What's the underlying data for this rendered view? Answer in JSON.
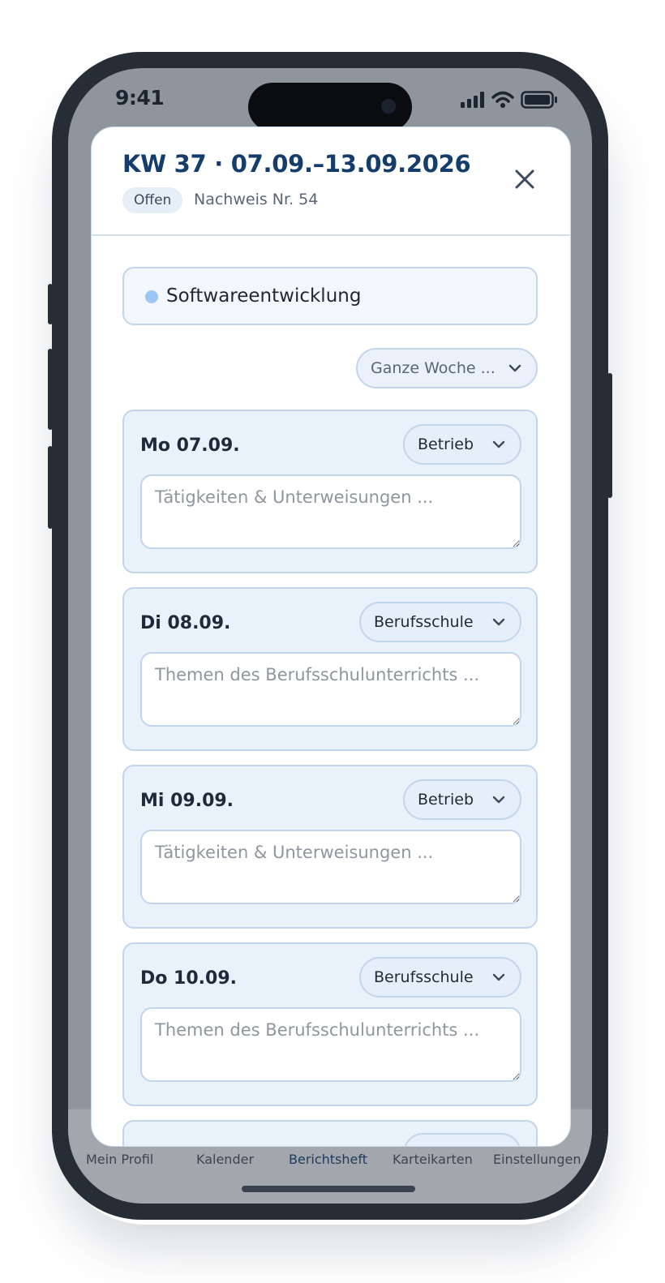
{
  "status": {
    "time": "9:41"
  },
  "sheet": {
    "title": "KW 37 · 07.09.–13.09.2026",
    "badge": "Offen",
    "nachweis": "Nachweis Nr. 54",
    "subject": "Softwareentwicklung",
    "week_select": "Ganze Woche ...",
    "days": [
      {
        "label": "Mo 07.09.",
        "type": "Betrieb",
        "placeholder": "Tätigkeiten & Unterweisungen ..."
      },
      {
        "label": "Di 08.09.",
        "type": "Berufsschule",
        "placeholder": "Themen des Berufsschulunterrichts ..."
      },
      {
        "label": "Mi 09.09.",
        "type": "Betrieb",
        "placeholder": "Tätigkeiten & Unterweisungen ..."
      },
      {
        "label": "Do 10.09.",
        "type": "Berufsschule",
        "placeholder": "Themen des Berufsschulunterrichts ..."
      }
    ]
  },
  "tabbar": {
    "items": [
      {
        "label": "Mein Profil"
      },
      {
        "label": "Kalender"
      },
      {
        "label": "Berichtsheft"
      },
      {
        "label": "Karteikarten"
      },
      {
        "label": "Einstellungen"
      }
    ],
    "active_index": 2
  },
  "colors": {
    "accent": "#143d6b",
    "card_bg": "#e9f1fb",
    "subject_dot": "#9cc7f3"
  }
}
